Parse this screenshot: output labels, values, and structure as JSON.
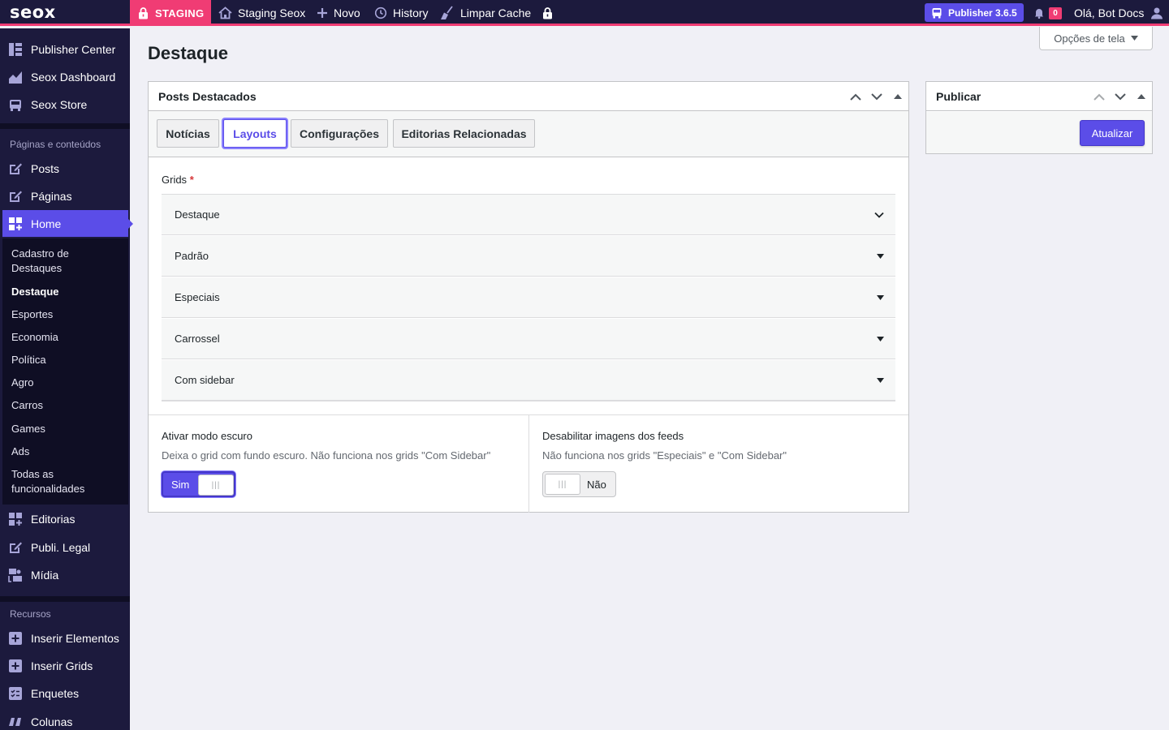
{
  "adminbar": {
    "logo": "seox",
    "staging": "STAGING",
    "site": "Staging Seox",
    "new": "Novo",
    "history": "History",
    "clear_cache": "Limpar Cache",
    "version": "Publisher 3.6.5",
    "notifications": "0",
    "greeting": "Olá, Bot Docs",
    "accent": "#f03c74",
    "bar_bg": "#1c1a3d"
  },
  "sidebar": {
    "top_items": [
      {
        "label": "Publisher Center",
        "icon": "dashboard-grid-icon"
      },
      {
        "label": "Seox Dashboard",
        "icon": "area-chart-icon"
      },
      {
        "label": "Seox Store",
        "icon": "store-icon"
      }
    ],
    "section1": "Páginas e conteúdos",
    "content_items": [
      {
        "label": "Posts",
        "icon": "edit-icon"
      },
      {
        "label": "Páginas",
        "icon": "edit-icon"
      }
    ],
    "active": {
      "label": "Home",
      "icon": "widgets-icon"
    },
    "submenu": [
      "Cadastro de Destaques",
      "Destaque",
      "Esportes",
      "Economia",
      "Política",
      "Agro",
      "Carros",
      "Games",
      "Ads",
      "Todas as funcionalidades"
    ],
    "submenu_current": "Destaque",
    "after_items": [
      {
        "label": "Editorias",
        "icon": "widgets-icon"
      },
      {
        "label": "Publi. Legal",
        "icon": "edit-icon"
      },
      {
        "label": "Mídia",
        "icon": "media-icon"
      }
    ],
    "section2": "Recursos",
    "resource_items": [
      {
        "label": "Inserir Elementos",
        "icon": "plus-square-icon"
      },
      {
        "label": "Inserir Grids",
        "icon": "plus-square-icon"
      },
      {
        "label": "Enquetes",
        "icon": "poll-icon"
      },
      {
        "label": "Colunas",
        "icon": "quote-icon"
      }
    ]
  },
  "page": {
    "title": "Destaque",
    "screen_options": "Opções de tela"
  },
  "main_box": {
    "title": "Posts Destacados",
    "tabs": [
      "Notícias",
      "Layouts",
      "Configurações",
      "Editorias Relacionadas"
    ],
    "active_tab": "Layouts",
    "grids_label": "Grids",
    "required_mark": "*",
    "grids": [
      "Destaque",
      "Padrão",
      "Especiais",
      "Carrossel",
      "Com sidebar"
    ],
    "dark_mode": {
      "title": "Ativar modo escuro",
      "desc": "Deixa o grid com fundo escuro. Não funciona nos grids \"Com Sidebar\"",
      "state": "Sim"
    },
    "disable_images": {
      "title": "Desabilitar imagens dos feeds",
      "desc": "Não funciona nos grids \"Especiais\" e \"Com Sidebar\"",
      "state": "Não"
    }
  },
  "publish_box": {
    "title": "Publicar",
    "button": "Atualizar"
  },
  "colors": {
    "primary": "#5b4de8",
    "page_bg": "#f0f0f6"
  }
}
